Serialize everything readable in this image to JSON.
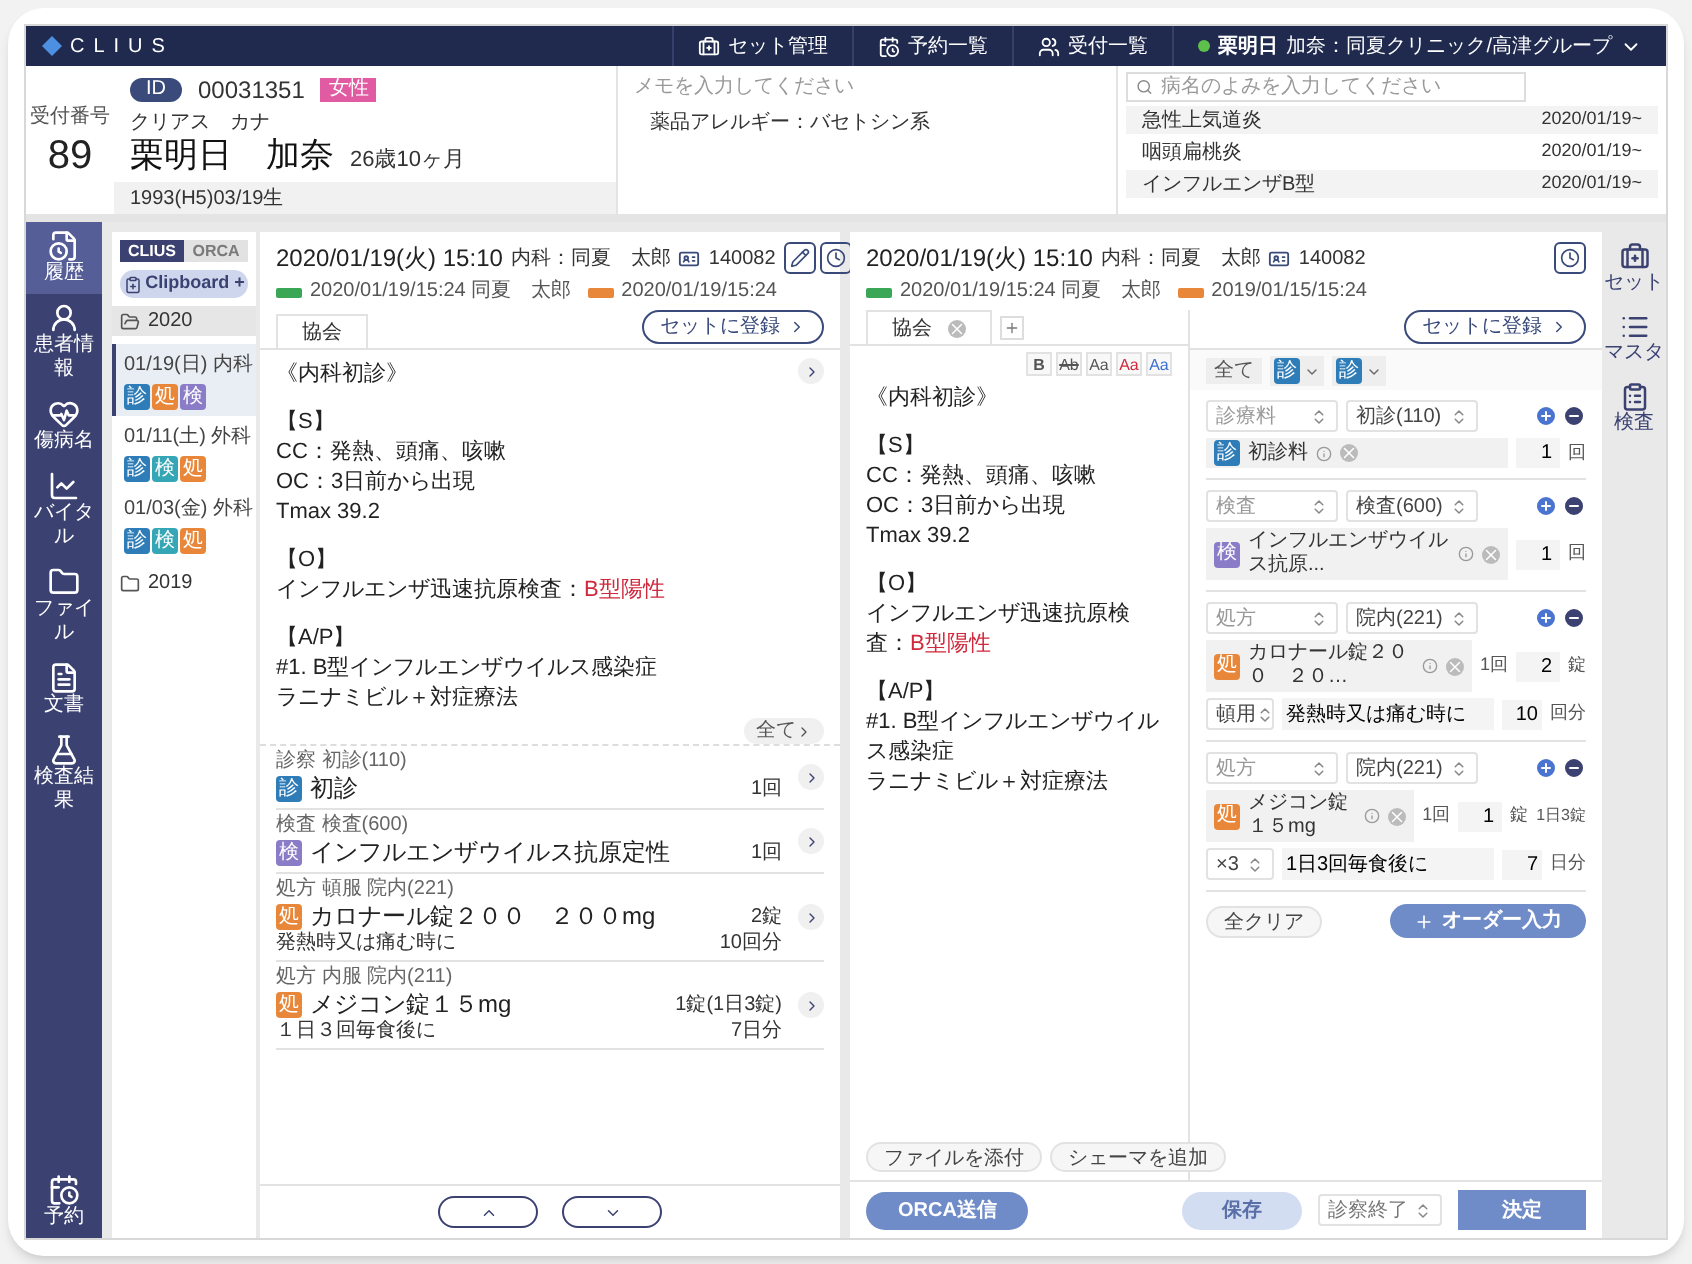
{
  "header": {
    "logo": "CLIUS",
    "nav": [
      {
        "label": "セット管理"
      },
      {
        "label": "予約一覧"
      },
      {
        "label": "受付一覧"
      }
    ],
    "user": {
      "online": true,
      "name": "栗明日",
      "clinic": "加奈：同夏クリニック/高津グループ"
    }
  },
  "patient": {
    "reception_label": "受付番号",
    "reception_no": "89",
    "id_label": "ID",
    "id": "00031351",
    "sex": "女性",
    "kana": "クリアス　カナ",
    "name": "栗明日　加奈",
    "age": "26歳10ヶ月",
    "birth": "1993(H5)03/19生"
  },
  "memo": {
    "placeholder": "メモを入力してください",
    "text": "薬品アレルギー：バセトシン系"
  },
  "diseases": {
    "placeholder": "病名のよみを入力してください",
    "items": [
      {
        "name": "急性上気道炎",
        "date": "2020/01/19~"
      },
      {
        "name": "咽頭扁桃炎",
        "date": "2020/01/19~"
      },
      {
        "name": "インフルエンザB型",
        "date": "2020/01/19~"
      }
    ]
  },
  "sidebar": {
    "items": [
      {
        "label": "履歴",
        "kind": "history",
        "selected": true
      },
      {
        "label": "患者情報",
        "kind": "patient",
        "selected": false
      },
      {
        "label": "傷病名",
        "kind": "disease",
        "selected": false
      },
      {
        "label": "バイタル",
        "kind": "vital",
        "selected": false
      },
      {
        "label": "ファイル",
        "kind": "file",
        "selected": false
      },
      {
        "label": "文書",
        "kind": "document",
        "selected": false
      },
      {
        "label": "検査結果",
        "kind": "lab",
        "selected": false
      }
    ],
    "bottom": {
      "label": "予約"
    }
  },
  "history": {
    "tabs": [
      {
        "label": "CLIUS",
        "selected": true
      },
      {
        "label": "ORCA",
        "selected": false
      }
    ],
    "clipboard": "Clipboard +",
    "years": [
      {
        "year": "2020",
        "expanded": true,
        "visits": [
          {
            "label": "01/19(日) 内科",
            "selected": true,
            "tags": [
              {
                "text": "診",
                "color": "#2f7db8"
              },
              {
                "text": "処",
                "color": "#e8873a"
              },
              {
                "text": "検",
                "color": "#8b7cc8"
              }
            ]
          },
          {
            "label": "01/11(土) 外科",
            "selected": false,
            "tags": [
              {
                "text": "診",
                "color": "#2f7db8"
              },
              {
                "text": "検",
                "color": "#35a6b5"
              },
              {
                "text": "処",
                "color": "#e8873a"
              }
            ]
          },
          {
            "label": "01/03(金) 外科",
            "selected": false,
            "tags": [
              {
                "text": "診",
                "color": "#2f7db8"
              },
              {
                "text": "検",
                "color": "#35a6b5"
              },
              {
                "text": "処",
                "color": "#e8873a"
              }
            ]
          }
        ]
      },
      {
        "year": "2019",
        "expanded": false
      }
    ]
  },
  "record": {
    "date": "2020/01/19(火) 15:10",
    "doctor": "内科：同夏　太郎",
    "id": "140082",
    "meta": [
      {
        "color": "#3aa757",
        "text": "2020/01/19/15:24 同夏　太郎"
      },
      {
        "color": "#e8873a",
        "text": "2020/01/19/15:24"
      }
    ],
    "tab": "協会",
    "register": "セットに登録",
    "note": [
      {
        "lines": [
          {
            "text": "《内科初診》"
          }
        ]
      },
      {
        "lines": [
          {
            "text": "【S】"
          },
          {
            "text": "CC：発熱、頭痛、咳嗽"
          },
          {
            "text": "OC：3日前から出現"
          },
          {
            "text": "Tmax 39.2"
          }
        ]
      },
      {
        "lines": [
          {
            "text": "【O】"
          },
          {
            "text": "インフルエンザ迅速抗原検査：",
            "alert": "B型陽性"
          }
        ]
      },
      {
        "lines": [
          {
            "text": "【A/P】"
          },
          {
            "text": "#1. B型インフルエンザウイルス感染症"
          },
          {
            "text": "ラニナミビル＋対症療法"
          }
        ]
      }
    ],
    "all_button": "全て",
    "orders": [
      {
        "category": "診察 初診(110)",
        "icon": "診",
        "color": "#2f7db8",
        "name": "初診",
        "qty": "1回"
      },
      {
        "category": "検査 検査(600)",
        "icon": "検",
        "color": "#8b7cc8",
        "name": "インフルエンザウイルス抗原定性",
        "qty": "1回"
      },
      {
        "category": "処方 頓服 院内(221)",
        "icon": "処",
        "color": "#e8873a",
        "name": "カロナール錠２００　２００mg",
        "qty": "2錠",
        "note": "発熱時又は痛む時に",
        "days": "10回分"
      },
      {
        "category": "処方 内服 院内(211)",
        "icon": "処",
        "color": "#e8873a",
        "name": "メジコン錠１５mg",
        "qty": "1錠(1日3錠)",
        "note": "１日３回毎食後に",
        "days": "7日分"
      }
    ]
  },
  "editor": {
    "date": "2020/01/19(火) 15:10",
    "doctor": "内科：同夏　太郎",
    "id": "140082",
    "meta": [
      {
        "color": "#3aa757",
        "text": "2020/01/19/15:24 同夏　太郎"
      },
      {
        "color": "#e8873a",
        "text": "2019/01/15/15:24"
      }
    ],
    "tab": "協会",
    "format_buttons": [
      {
        "label": "B",
        "kind": "bold"
      },
      {
        "label": "Ab",
        "kind": "strike"
      },
      {
        "label": "Aa",
        "kind": "plain"
      },
      {
        "label": "Aa",
        "kind": "red"
      },
      {
        "label": "Aa",
        "kind": "blue"
      }
    ],
    "note": [
      {
        "lines": [
          {
            "text": "《内科初診》"
          }
        ]
      },
      {
        "lines": [
          {
            "text": "【S】"
          },
          {
            "text": "CC：発熱、頭痛、咳嗽"
          },
          {
            "text": "OC：3日前から出現"
          },
          {
            "text": "Tmax 39.2"
          }
        ]
      },
      {
        "lines": [
          {
            "text": "【O】"
          },
          {
            "text": "インフルエンザ迅速抗原検査：",
            "alert": "B型陽性"
          }
        ]
      },
      {
        "lines": [
          {
            "text": "【A/P】"
          },
          {
            "text": "#1. B型インフルエンザウイルス感染症"
          },
          {
            "text": "ラニナミビル＋対症療法"
          }
        ]
      }
    ],
    "attach_buttons": [
      "ファイルを添付",
      "シェーマを追加"
    ],
    "register": "セットに登録",
    "filter": {
      "all": "全て",
      "dropdowns": [
        {
          "icon": "診",
          "color": "#2f7db8"
        },
        {
          "icon": "診",
          "color": "#2f7db8"
        }
      ]
    },
    "orders": [
      {
        "type": "診療料",
        "group": "初診(110)",
        "icon": "診",
        "color": "#2f7db8",
        "name": "初診料",
        "qty": "1",
        "unit": "回"
      },
      {
        "type": "検査",
        "group": "検査(600)",
        "icon": "検",
        "color": "#8b7cc8",
        "name": "インフルエンザウイルス抗原...",
        "qty": "1",
        "unit": "回"
      },
      {
        "type": "処方",
        "group": "院内(221)",
        "icon": "処",
        "color": "#e8873a",
        "name": "カロナール錠２００　２０…",
        "dose_label": "1回",
        "qty": "2",
        "unit": "錠",
        "usage": "頓用",
        "instruction": "発熱時又は痛む時に",
        "days": "10",
        "days_unit": "回分"
      },
      {
        "type": "処方",
        "group": "院内(221)",
        "icon": "処",
        "color": "#e8873a",
        "name": "メジコン錠１５mg",
        "dose_label": "1回",
        "qty": "1",
        "unit": "錠",
        "daily": "1日3錠",
        "usage": "×3",
        "instruction": "1日3回毎食後に",
        "days": "7",
        "days_unit": "日分"
      }
    ],
    "clear": "全クリア",
    "add_order": "オーダー入力"
  },
  "footer": {
    "send": "ORCA送信",
    "save": {
      "label": "保存",
      "disabled": true
    },
    "status": "診察終了",
    "confirm": "決定"
  },
  "rail": [
    {
      "label": "セット",
      "kind": "set"
    },
    {
      "label": "マスタ",
      "kind": "master"
    },
    {
      "label": "検査",
      "kind": "lab"
    }
  ]
}
